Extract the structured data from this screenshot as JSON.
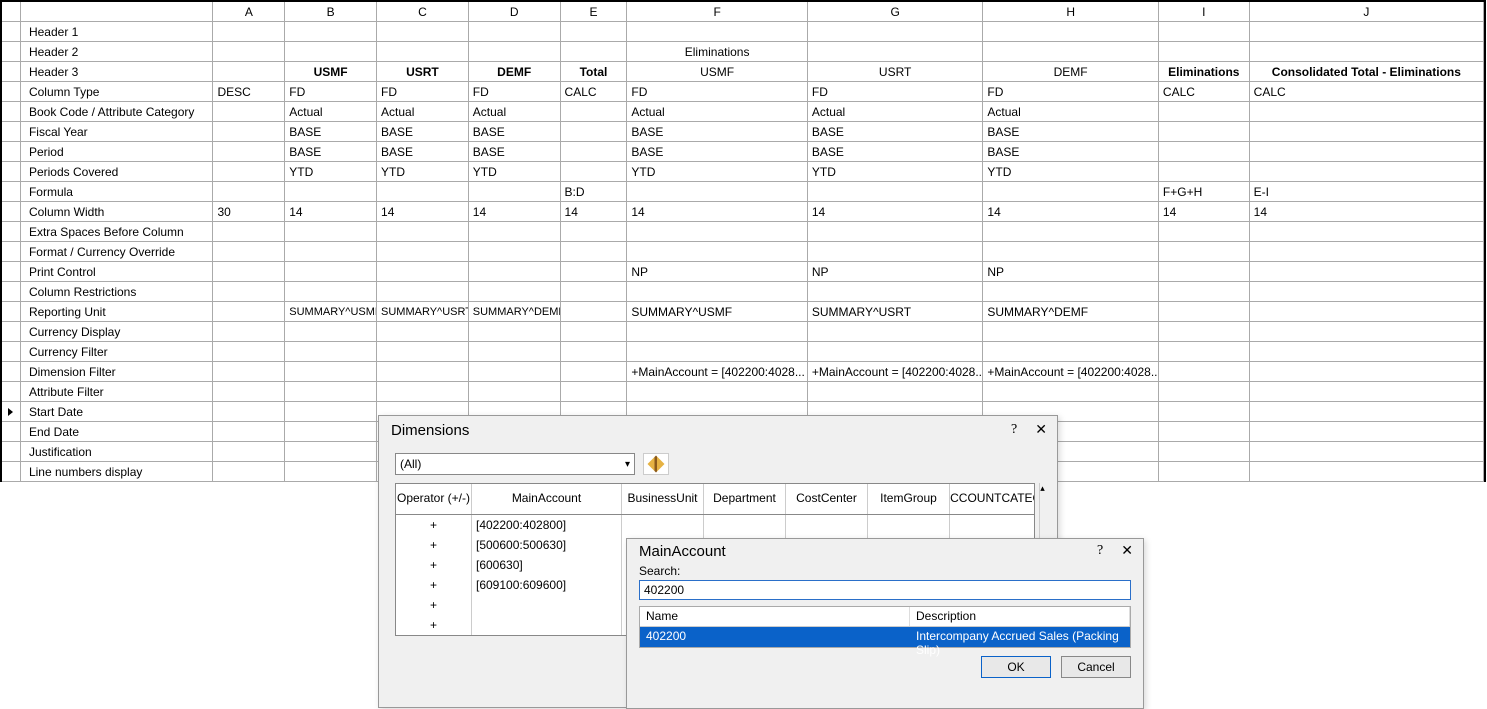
{
  "columns": {
    "A": "A",
    "B": "B",
    "C": "C",
    "D": "D",
    "E": "E",
    "F": "F",
    "G": "G",
    "H": "H",
    "I": "I",
    "J": "J"
  },
  "labels": {
    "h1": "Header 1",
    "h2": "Header 2",
    "h3": "Header 3",
    "ct": "Column Type",
    "bc": "Book Code / Attribute Category",
    "fy": "Fiscal Year",
    "pd": "Period",
    "pc": "Periods Covered",
    "fm": "Formula",
    "cw": "Column Width",
    "es": "Extra Spaces Before Column",
    "fo": "Format / Currency Override",
    "pctrl": "Print Control",
    "cr": "Column Restrictions",
    "ru": "Reporting Unit",
    "cd": "Currency Display",
    "cf": "Currency Filter",
    "df": "Dimension Filter",
    "af": "Attribute Filter",
    "sd": "Start Date",
    "ed": "End Date",
    "jst": "Justification",
    "lnd": "Line numbers display"
  },
  "header2": {
    "F": "Eliminations"
  },
  "header3": {
    "B": "USMF",
    "C": "USRT",
    "D": "DEMF",
    "E": "Total",
    "F": "USMF",
    "G": "USRT",
    "H": "DEMF",
    "I": "Eliminations",
    "J": "Consolidated Total - Eliminations"
  },
  "rows": {
    "ct": {
      "A": "DESC",
      "B": "FD",
      "C": "FD",
      "D": "FD",
      "E": "CALC",
      "F": "FD",
      "G": "FD",
      "H": "FD",
      "I": "CALC",
      "J": "CALC"
    },
    "bc": {
      "B": "Actual",
      "C": "Actual",
      "D": "Actual",
      "F": "Actual",
      "G": "Actual",
      "H": "Actual"
    },
    "fy": {
      "B": "BASE",
      "C": "BASE",
      "D": "BASE",
      "F": "BASE",
      "G": "BASE",
      "H": "BASE"
    },
    "pd": {
      "B": "BASE",
      "C": "BASE",
      "D": "BASE",
      "F": "BASE",
      "G": "BASE",
      "H": "BASE"
    },
    "pc": {
      "B": "YTD",
      "C": "YTD",
      "D": "YTD",
      "F": "YTD",
      "G": "YTD",
      "H": "YTD"
    },
    "fm": {
      "E": "B:D",
      "I": "F+G+H",
      "J": "E-I"
    },
    "cw": {
      "A": "30",
      "B": "14",
      "C": "14",
      "D": "14",
      "E": "14",
      "F": "14",
      "G": "14",
      "H": "14",
      "I": "14",
      "J": "14"
    },
    "pctrl": {
      "F": "NP",
      "G": "NP",
      "H": "NP"
    },
    "ru": {
      "B": "SUMMARY^USMF",
      "C": "SUMMARY^USRT",
      "D": "SUMMARY^DEMF",
      "F": "SUMMARY^USMF",
      "G": "SUMMARY^USRT",
      "H": "SUMMARY^DEMF"
    },
    "df": {
      "F": "+MainAccount = [402200:4028...",
      "G": "+MainAccount = [402200:4028...",
      "H": "+MainAccount = [402200:4028..."
    }
  },
  "dimDialog": {
    "title": "Dimensions",
    "filter": "(All)",
    "cols": {
      "op": "Operator (+/-)",
      "ma": "MainAccount",
      "bu": "BusinessUnit",
      "dep": "Department",
      "cc": "CostCenter",
      "ig": "ItemGroup",
      "ac": "ACCOUNTCATEG"
    },
    "rows": [
      {
        "op": "+",
        "ma": "[402200:402800]"
      },
      {
        "op": "+",
        "ma": "[500600:500630]"
      },
      {
        "op": "+",
        "ma": "[600630]"
      },
      {
        "op": "+",
        "ma": "[609100:609600]"
      },
      {
        "op": "+",
        "ma": ""
      },
      {
        "op": "+",
        "ma": ""
      }
    ]
  },
  "maDialog": {
    "title": "MainAccount",
    "searchLabel": "Search:",
    "searchValue": "402200",
    "cols": {
      "name": "Name",
      "desc": "Description"
    },
    "result": {
      "name": "402200",
      "desc": "Intercompany Accrued Sales (Packing Slip)"
    },
    "ok": "OK",
    "cancel": "Cancel"
  }
}
